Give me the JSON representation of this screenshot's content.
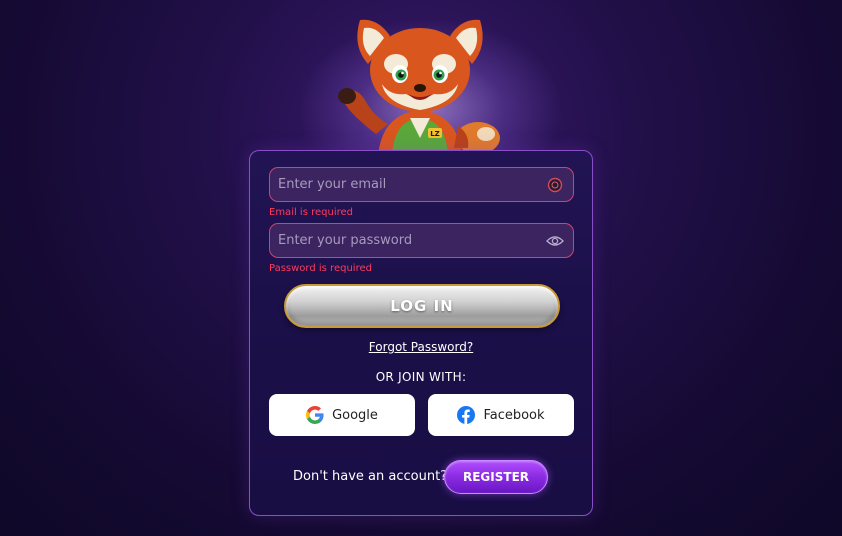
{
  "form": {
    "email_placeholder": "Enter your email",
    "email_error": "Email is required",
    "password_placeholder": "Enter your password",
    "password_error": "Password is required",
    "login_label": "LOG IN",
    "forgot_label": "Forgot Password?",
    "join_label": "OR JOIN WITH:",
    "google_label": "Google",
    "facebook_label": "Facebook",
    "no_account_text": "Don't have an account?",
    "register_label": "REGISTER"
  },
  "icons": {
    "email_field": "email-status-icon",
    "password_field": "eye-icon",
    "google": "google-logo-icon",
    "facebook": "facebook-logo-icon",
    "mascot": "red-panda-mascot"
  },
  "mascot": {
    "badge_text": "LZ"
  },
  "colors": {
    "error": "#ff3b5c",
    "field_border": "#d1436e",
    "card_border": "#8a4fc7",
    "login_border": "#c89a3a",
    "register_bg": "#8a2be2",
    "facebook_blue": "#1877f2"
  }
}
